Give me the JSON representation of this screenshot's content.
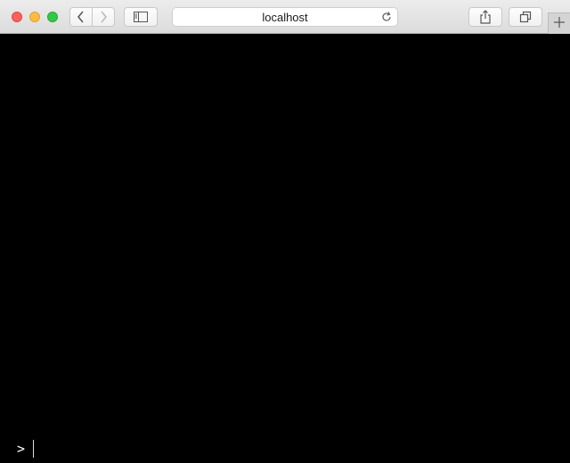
{
  "window": {
    "address": "localhost"
  },
  "toolbar": {
    "icons": {
      "close": "close-traffic-light",
      "minimize": "minimize-traffic-light",
      "maximize": "maximize-traffic-light",
      "back": "chevron-left-icon",
      "forward": "chevron-right-icon",
      "sidebar": "sidebar-icon",
      "reload": "reload-icon",
      "share": "share-icon",
      "tabs": "tabs-overview-icon",
      "new_tab": "plus-icon"
    },
    "colors": {
      "close": "#fc605c",
      "minimize": "#fdbc40",
      "maximize": "#34c84a"
    }
  },
  "terminal": {
    "prompt": ">",
    "input": "",
    "background": "#000000",
    "foreground": "#ffffff"
  }
}
